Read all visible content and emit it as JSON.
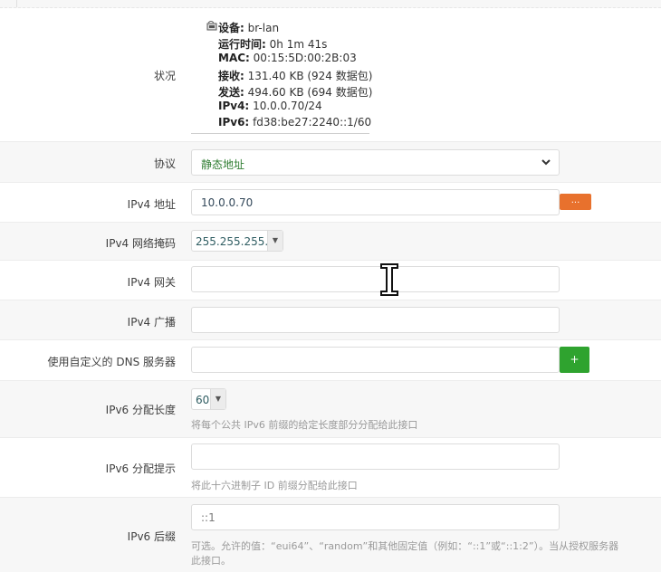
{
  "status": {
    "label": "状况",
    "device_key": "设备:",
    "device_val": "br-lan",
    "uptime_key": "运行时间:",
    "uptime_val": "0h 1m 41s",
    "mac_key": "MAC:",
    "mac_val": "00:15:5D:00:2B:03",
    "rx_key": "接收:",
    "rx_val": "131.40 KB (924 数据包)",
    "tx_key": "发送:",
    "tx_val": "494.60 KB (694 数据包)",
    "ipv4_key": "IPv4:",
    "ipv4_val": "10.0.0.70/24",
    "ipv6_key": "IPv6:",
    "ipv6_val": "fd38:be27:2240::1/60"
  },
  "protocol": {
    "label": "协议",
    "value": "静态地址"
  },
  "ipv4_addr": {
    "label": "IPv4 地址",
    "value": "10.0.0.70",
    "button": "..."
  },
  "ipv4_mask": {
    "label": "IPv4 网络掩码",
    "value": "255.255.255.0"
  },
  "ipv4_gateway": {
    "label": "IPv4 网关",
    "value": ""
  },
  "ipv4_broadcast": {
    "label": "IPv4 广播",
    "value": ""
  },
  "dns": {
    "label": "使用自定义的 DNS 服务器",
    "value": "",
    "button": "+"
  },
  "ipv6_len": {
    "label": "IPv6 分配长度",
    "value": "60",
    "help": "将每个公共 IPv6 前缀的给定长度部分分配给此接口"
  },
  "ipv6_hint": {
    "label": "IPv6 分配提示",
    "value": "",
    "help": "将此十六进制子 ID 前缀分配给此接口"
  },
  "ipv6_suffix": {
    "label": "IPv6 后缀",
    "value": "::1",
    "help1": "可选。允许的值：“eui64”、“random”和其他固定值（例如：“::1”或“::1:2”）。当从授权服务器",
    "help2": "此接口。"
  },
  "colors": {
    "accent": "#e8712d",
    "add": "#2fa32f",
    "select_text": "#2f7d32"
  }
}
